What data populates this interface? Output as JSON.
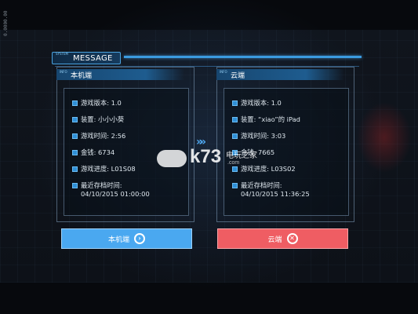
{
  "side_text": "0.0000.00",
  "dialog": {
    "tab_small": "SYSTEM",
    "title": "MESSAGE"
  },
  "local": {
    "tag": "INFO",
    "header": "本机端",
    "version": "游戏版本: 1.0",
    "device": "装置: 小小小葵",
    "playtime": "游戏时间: 2:56",
    "money": "金钱: 6734",
    "progress": "游戏进度: L01S08",
    "last_save_label": "最近存档时间:",
    "last_save_value": "04/10/2015 01:00:00"
  },
  "cloud": {
    "tag": "INFO",
    "header": "云端",
    "version": "游戏版本: 1.0",
    "device": "装置: “xiao”的 iPad",
    "playtime": "游戏时间: 3:03",
    "money": "金钱: 7665",
    "progress": "游戏进度: L03S02",
    "last_save_label": "最近存档时间:",
    "last_save_value": "04/10/2015 11:36:25"
  },
  "arrows": "»",
  "watermark": {
    "logo": "k73",
    "site": "电玩之家",
    "domain": ".com"
  },
  "buttons": {
    "local_label": "本机端",
    "cloud_label": "云端",
    "local_icon": "chevron-right-circle-icon",
    "cloud_icon": "close-circle-icon"
  },
  "colors": {
    "accent_blue": "#4aa8f0",
    "accent_red": "#ef5d63"
  }
}
